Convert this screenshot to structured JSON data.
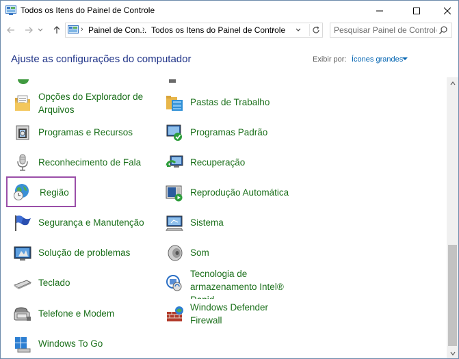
{
  "window": {
    "title": "Todos os Itens do Painel de Controle"
  },
  "nav": {
    "breadcrumbs": [
      "Painel de Con...",
      "Todos os Itens do Painel de Controle"
    ],
    "search_placeholder": "Pesquisar Painel de Controle"
  },
  "header": {
    "title": "Ajuste as configurações do computador",
    "view_by_label": "Exibir por:",
    "view_by_value": "Ícones grandes"
  },
  "items": {
    "left": [
      {
        "label": "Opções do Explorador de",
        "label2": "Arquivos",
        "icon": "folder-options-icon"
      },
      {
        "label": "Programas e Recursos",
        "icon": "programs-features-icon"
      },
      {
        "label": "Reconhecimento de Fala",
        "icon": "microphone-icon"
      },
      {
        "label": "Região",
        "icon": "globe-clock-icon",
        "selected": true
      },
      {
        "label": "Segurança e Manutenção",
        "icon": "flag-icon"
      },
      {
        "label": "Solução de problemas",
        "icon": "troubleshooting-icon"
      },
      {
        "label": "Teclado",
        "icon": "keyboard-icon"
      },
      {
        "label": "Telefone e Modem",
        "icon": "phone-modem-icon"
      },
      {
        "label": "Windows To Go",
        "icon": "windows-to-go-icon"
      }
    ],
    "right": [
      {
        "label": "Pastas de Trabalho",
        "icon": "work-folders-icon"
      },
      {
        "label": "Programas Padrão",
        "icon": "default-programs-icon"
      },
      {
        "label": "Recuperação",
        "icon": "recovery-icon"
      },
      {
        "label": "Reprodução Automática",
        "icon": "autoplay-icon"
      },
      {
        "label": "Sistema",
        "icon": "system-icon"
      },
      {
        "label": "Som",
        "icon": "speaker-icon"
      },
      {
        "label": "Tecnologia de",
        "label2": "armazenamento Intel®",
        "label3": "Rapid",
        "icon": "intel-storage-icon"
      },
      {
        "label": "Windows Defender",
        "label2": "Firewall",
        "icon": "firewall-icon"
      }
    ]
  },
  "colors": {
    "link_green": "#1a6f1a",
    "title_blue": "#1e3287",
    "selection": "#9a4ea8"
  }
}
